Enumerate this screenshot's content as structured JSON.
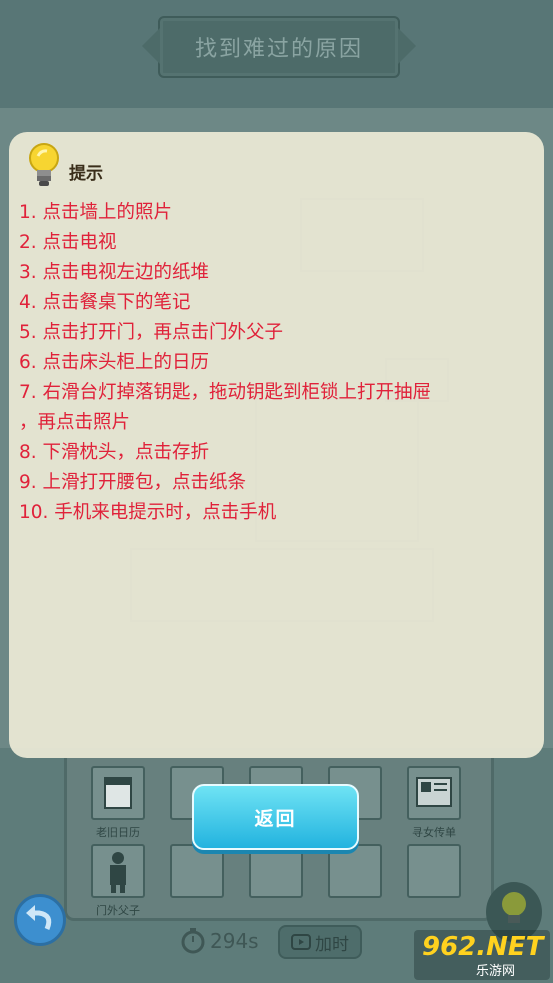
{
  "header": {
    "title": "找到难过的原因"
  },
  "hint_panel": {
    "title": "提示",
    "steps": [
      "1. 点击墙上的照片",
      "2. 点击电视",
      "3. 点击电视左边的纸堆",
      "4. 点击餐桌下的笔记",
      "5. 点击打开门，再点击门外父子",
      "6. 点击床头柜上的日历",
      "7. 右滑台灯掉落钥匙，拖动钥匙到柜锁上打开抽屉",
      "，再点击照片",
      "8. 下滑枕头，点击存折",
      "9. 上滑打开腰包，点击纸条",
      "10. 手机来电提示时，点击手机"
    ]
  },
  "inventory": {
    "labels": [
      "老旧日历",
      "",
      "",
      "",
      "寻女传单",
      "门外父子"
    ]
  },
  "back_button": {
    "label": "返回"
  },
  "timer": {
    "value": "294s"
  },
  "add_time_button": {
    "label": "加时"
  },
  "watermark": {
    "main": "962.NET",
    "sub": "乐游网"
  },
  "colors": {
    "hint_text": "#e0223a",
    "button": "#22b3df"
  }
}
